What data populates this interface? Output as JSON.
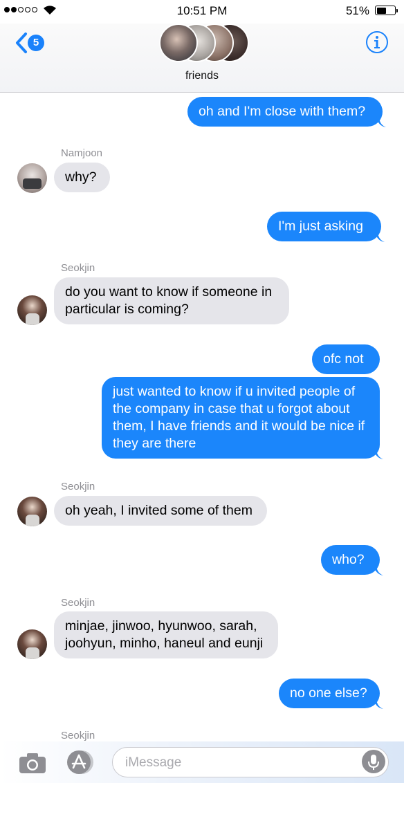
{
  "status_bar": {
    "signal_filled": 2,
    "signal_total": 5,
    "time": "10:51 PM",
    "battery_percent": "51%",
    "battery_level": 0.51
  },
  "header": {
    "back_badge": "5",
    "group_name": "friends"
  },
  "messages": [
    {
      "direction": "out",
      "text": "oh and I'm close with them?"
    },
    {
      "direction": "in",
      "sender": "Namjoon",
      "text": "why?"
    },
    {
      "direction": "out",
      "text": "I'm just asking"
    },
    {
      "direction": "in",
      "sender": "Seokjin",
      "text": "do you want to know if someone in particular is coming?"
    },
    {
      "direction": "out",
      "text": "ofc not"
    },
    {
      "direction": "out",
      "text": "just wanted to know if u invited people of the company in case that u forgot about them, I have friends and it would be nice if they are there"
    },
    {
      "direction": "in",
      "sender": "Seokjin",
      "text": "oh yeah, I invited some of them"
    },
    {
      "direction": "out",
      "text": "who?"
    },
    {
      "direction": "in",
      "sender": "Seokjin",
      "text": "minjae, jinwoo, hyunwoo, sarah, joohyun, minho, haneul and eunji"
    },
    {
      "direction": "out",
      "text": "no one else?"
    },
    {
      "direction": "in",
      "sender": "Seokjin"
    }
  ],
  "composer": {
    "placeholder": "iMessage"
  },
  "colors": {
    "outgoing_bubble": "#1b86fb",
    "incoming_bubble": "#e5e5ea",
    "accent": "#1a82fb"
  }
}
